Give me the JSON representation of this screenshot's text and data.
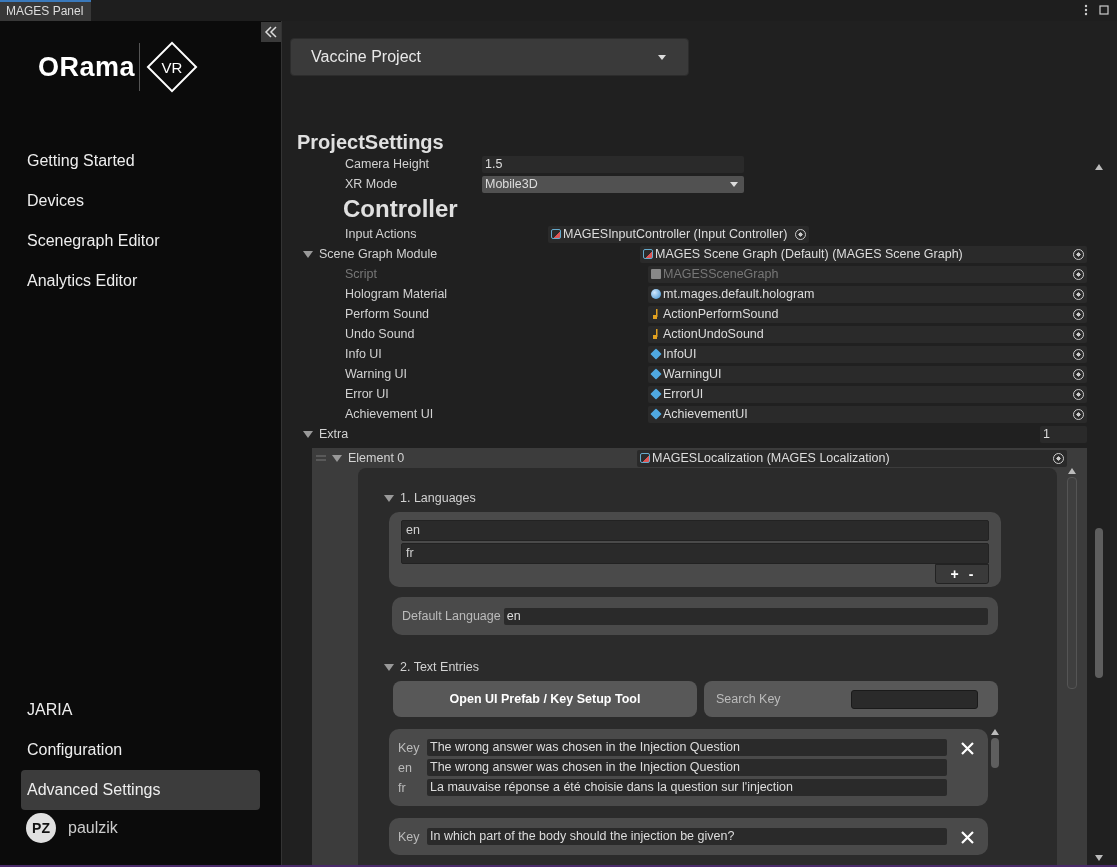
{
  "window": {
    "title": "MAGES Panel"
  },
  "logo": {
    "text": "ORama",
    "badge": "VR"
  },
  "sidebar": {
    "top_items": [
      {
        "label": "Getting Started",
        "selected": false
      },
      {
        "label": "Devices",
        "selected": false
      },
      {
        "label": "Scenegraph Editor",
        "selected": false
      },
      {
        "label": "Analytics Editor",
        "selected": false
      }
    ],
    "bottom_items": [
      {
        "label": "JARIA",
        "selected": false
      },
      {
        "label": "Configuration",
        "selected": false
      },
      {
        "label": "Advanced Settings",
        "selected": true
      }
    ],
    "user": {
      "initials": "PZ",
      "name": "paulzik"
    }
  },
  "project_dropdown": {
    "value": "Vaccine Project"
  },
  "inspector": {
    "title": "ProjectSettings",
    "rows": [
      {
        "kind": "text",
        "label": "Camera Height",
        "value": "1.5"
      },
      {
        "kind": "dropdown",
        "label": "XR Mode",
        "value": "Mobile3D"
      },
      {
        "kind": "header",
        "label": "Controller"
      },
      {
        "kind": "object",
        "label": "Input Actions",
        "value": "MAGESInputController (Input Controller)"
      },
      {
        "kind": "foldout",
        "label": "Scene Graph Module",
        "value": "MAGES Scene Graph (Default) (MAGES Scene Graph)",
        "expanded": true,
        "children": [
          {
            "kind": "script",
            "label": "Script",
            "value": "MAGESSceneGraph",
            "disabled": true
          },
          {
            "kind": "material",
            "label": "Hologram Material",
            "value": "mt.mages.default.hologram",
            "disabled": false
          },
          {
            "kind": "audio",
            "label": "Perform Sound",
            "value": "ActionPerformSound",
            "disabled": false
          },
          {
            "kind": "audio",
            "label": "Undo Sound",
            "value": "ActionUndoSound",
            "disabled": false
          },
          {
            "kind": "prefab",
            "label": "Info UI",
            "value": "InfoUI",
            "disabled": false
          },
          {
            "kind": "prefab",
            "label": "Warning UI",
            "value": "WarningUI",
            "disabled": false
          },
          {
            "kind": "prefab",
            "label": "Error UI",
            "value": "ErrorUI",
            "disabled": false
          },
          {
            "kind": "prefab",
            "label": "Achievement UI",
            "value": "AchievementUI",
            "disabled": false
          }
        ]
      }
    ],
    "extra": {
      "label": "Extra",
      "count": "1",
      "expanded": true,
      "element": {
        "label": "Element 0",
        "value": "MAGESLocalization (MAGES Localization)",
        "expanded": true,
        "languages": {
          "title": "1. Languages",
          "expanded": true,
          "items": [
            "en",
            "fr"
          ],
          "add": "+",
          "remove": "-"
        },
        "default_language": {
          "label": "Default Language",
          "value": "en"
        },
        "text_entries": {
          "title": "2. Text Entries",
          "expanded": true,
          "open_button": "Open UI Prefab / Key Setup Tool",
          "search_label": "Search Key",
          "entries": [
            {
              "lines": [
                {
                  "label": "Key",
                  "value": "The wrong answer was chosen in the Injection Question"
                },
                {
                  "label": "en",
                  "value": "The wrong answer was chosen in the Injection Question"
                },
                {
                  "label": "fr",
                  "value": "La mauvaise réponse a été choisie dans la question sur l'injection"
                }
              ]
            },
            {
              "lines": [
                {
                  "label": "Key",
                  "value": "In which part of the body should the injection be given?"
                }
              ]
            }
          ]
        }
      }
    }
  }
}
